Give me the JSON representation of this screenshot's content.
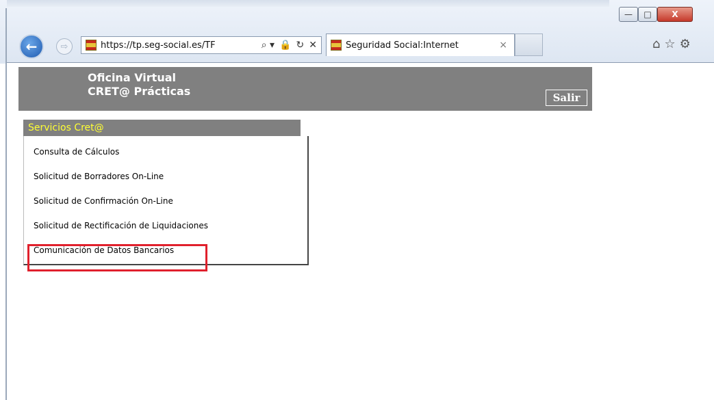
{
  "browser": {
    "address_url": "https://tp.seg-social.es/TF",
    "tab_title": "Seguridad Social:Internet",
    "tab_close": "×",
    "back_glyph": "←",
    "forward_glyph": "⇨",
    "address_icons": [
      "⌕ ▾",
      "🔒",
      "↻",
      "✕"
    ],
    "toolbar_icons": [
      "⌂",
      "☆",
      "⚙"
    ],
    "window_buttons": {
      "min": "—",
      "max": "□",
      "close": "X"
    }
  },
  "header": {
    "title_line1": "Oficina Virtual",
    "title_line2": "CRET@ Prácticas",
    "salir_label": "Salir"
  },
  "menu": {
    "header": "Servicios Cret@",
    "items": [
      {
        "label": "Consulta de Cálculos"
      },
      {
        "label": "Solicitud de Borradores On-Line"
      },
      {
        "label": "Solicitud de Confirmación On-Line"
      },
      {
        "label": "Solicitud de Rectificación de Liquidaciones"
      },
      {
        "label": "Comunicación de Datos Bancarios"
      }
    ]
  },
  "colors": {
    "header_bg": "#808080",
    "menu_header_text": "#ffff33",
    "highlight_border": "#e0202c"
  }
}
